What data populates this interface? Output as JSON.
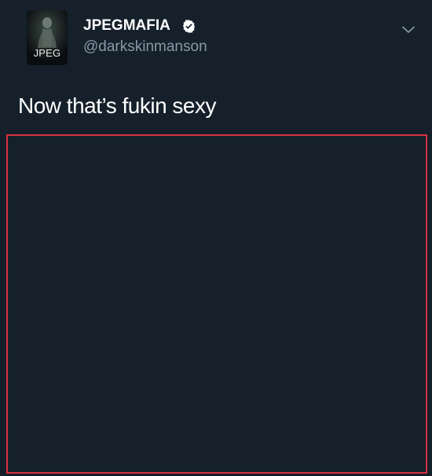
{
  "tweet": {
    "author": {
      "display_name": "JPEGMAFIA",
      "handle": "@darkskinmanson",
      "verified": true,
      "avatar_label": "JPEG"
    },
    "text": "Now that’s fukin sexy",
    "media": {
      "state": "blank"
    }
  },
  "icons": {
    "verified": "verified-badge-icon",
    "menu": "chevron-down-icon"
  },
  "colors": {
    "background": "#15202b",
    "text_primary": "#ffffff",
    "text_secondary": "#8899a6",
    "media_border": "#d9313d"
  }
}
